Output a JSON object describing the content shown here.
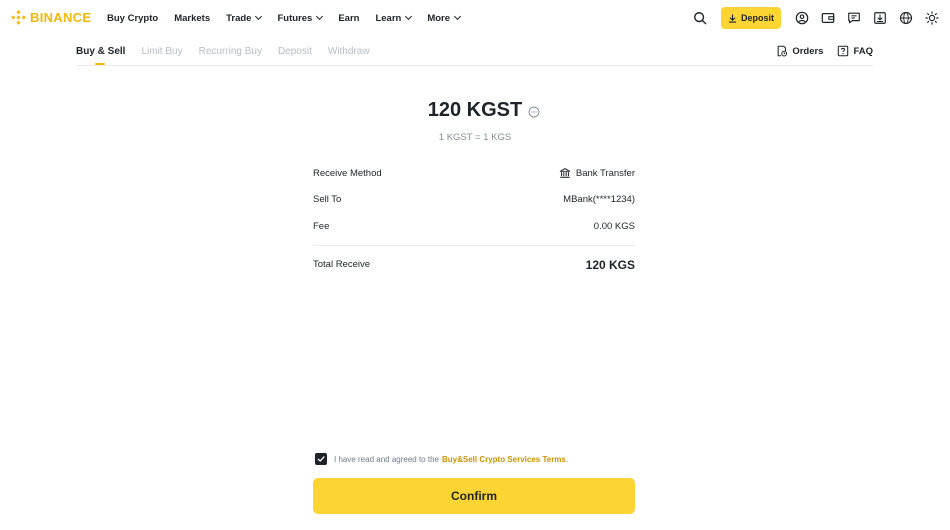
{
  "brand": {
    "name": "BINANCE",
    "color": "#f0b90b"
  },
  "topnav": {
    "items": [
      {
        "label": "Buy Crypto",
        "dropdown": false
      },
      {
        "label": "Markets",
        "dropdown": false
      },
      {
        "label": "Trade",
        "dropdown": true
      },
      {
        "label": "Futures",
        "dropdown": true
      },
      {
        "label": "Earn",
        "dropdown": false
      },
      {
        "label": "Learn",
        "dropdown": true
      },
      {
        "label": "More",
        "dropdown": true
      }
    ],
    "deposit_label": "Deposit",
    "icons": [
      "search-icon",
      "download-icon",
      "profile-icon",
      "wallet-icon",
      "messages-icon",
      "app-download-icon",
      "globe-icon",
      "theme-toggle-icon"
    ]
  },
  "subnav": {
    "tabs": [
      {
        "label": "Buy & Sell",
        "active": true
      },
      {
        "label": "Limit Buy",
        "active": false
      },
      {
        "label": "Recurring Buy",
        "active": false
      },
      {
        "label": "Deposit",
        "active": false
      },
      {
        "label": "Withdraw",
        "active": false
      }
    ],
    "orders_label": "Orders",
    "faq_label": "FAQ"
  },
  "order": {
    "amount": "120 KGST",
    "rate": "1 KGST = 1 KGS",
    "receive_method_label": "Receive Method",
    "receive_method_value": "Bank Transfer",
    "sell_to_label": "Sell To",
    "sell_to_value": "MBank(****1234)",
    "fee_label": "Fee",
    "fee_value": "0.00 KGS",
    "total_label": "Total Receive",
    "total_value": "120 KGS"
  },
  "agreement": {
    "checked": true,
    "text": "I have read and agreed to the",
    "link": "Buy&Sell Crypto Services Terms",
    "suffix": "."
  },
  "confirm_label": "Confirm",
  "colors": {
    "accent": "#fcd535",
    "link": "#c99400",
    "text": "#1e2329",
    "muted": "#848e9c"
  }
}
